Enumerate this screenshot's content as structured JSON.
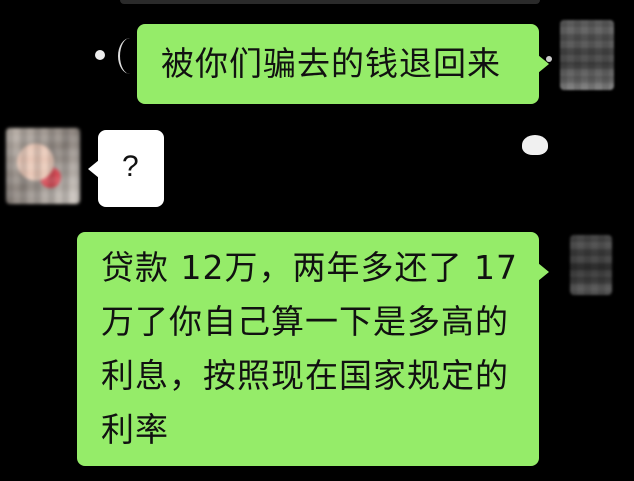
{
  "chat": {
    "messages": [
      {
        "side": "right",
        "type": "outgoing",
        "text": "被你们骗去的钱退回来"
      },
      {
        "side": "left",
        "type": "incoming",
        "text": "?"
      },
      {
        "side": "right",
        "type": "outgoing",
        "text": "贷款 12万，两年多还了 17 万了你自己算一下是多高的利息，按照现在国家规定的利率"
      }
    ]
  },
  "colors": {
    "background": "#000000",
    "outgoing_bubble": "#95ec69",
    "incoming_bubble": "#ffffff",
    "text": "#111111"
  },
  "icons": [
    "avatar-left",
    "avatar-right"
  ]
}
